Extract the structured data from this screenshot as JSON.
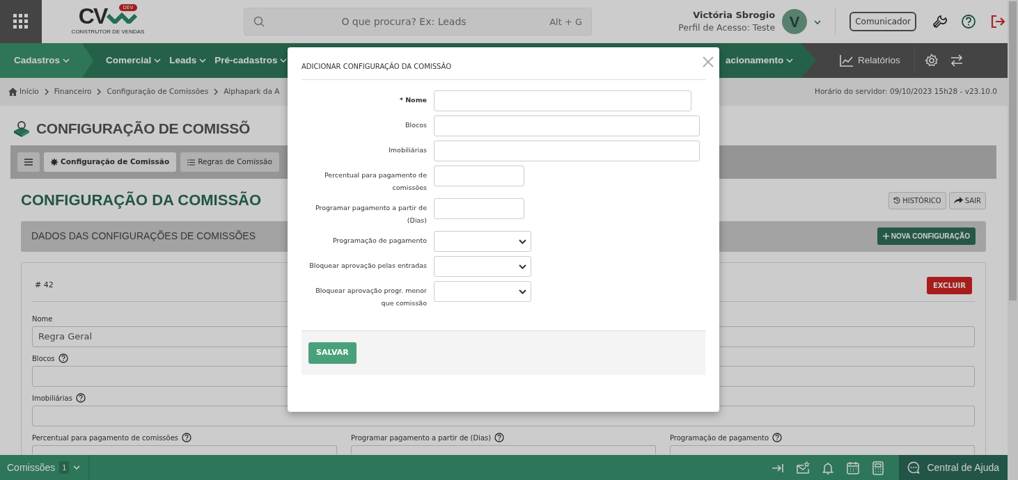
{
  "topbar": {
    "logo_text": "CV",
    "logo_badge": "DEV",
    "logo_subtitle": "CONSTRUTOR DE VENDAS",
    "search_placeholder": "O que procura? Ex: Leads",
    "search_shortcut": "Alt + G",
    "user": {
      "name": "Victória Sbrogio",
      "profile": "Perfil de Acesso: Teste",
      "initial": "V"
    },
    "communicator": "Comunicador"
  },
  "nav": {
    "items": [
      {
        "label": "Cadastros",
        "selected": true
      },
      {
        "label": "Comercial",
        "selected": false
      },
      {
        "label": "Leads",
        "selected": false
      },
      {
        "label": "Pré-cadastros",
        "selected": false
      },
      {
        "label": "acionamento",
        "selected": false
      }
    ],
    "reports": "Relatórios"
  },
  "breadcrumb": [
    "Início",
    "Financeiro",
    "Configuração de Comissões",
    "Alphapark da A"
  ],
  "server_time": "Horário do servidor: 09/10/2023 15h28 - v23.10.0",
  "page_title": "CONFIGURAÇÃO DE COMISSÕ",
  "tabs": [
    {
      "label": "Configuração de Comissão",
      "selected": true
    },
    {
      "label": "Regras de Comissão",
      "selected": false
    }
  ],
  "section_title": "CONFIGURAÇÃO DA COMISSÃO",
  "actions": [
    "HISTÓRICO",
    "SAIR"
  ],
  "panel_title": "DADOS DAS CONFIGURAÇÕES DE COMISSÕES",
  "new_button": "NOVA CONFIGURAÇÃO",
  "record": {
    "id": "# 42",
    "delete": "EXCLUIR",
    "fields": [
      {
        "label": "Nome",
        "value": "Regra Geral",
        "help": false
      },
      {
        "label": "Blocos",
        "help": true
      },
      {
        "label": "Imobiliárias",
        "help": true
      },
      {
        "label": "Percentual para pagamento de comissões",
        "help": true
      },
      {
        "label": "Programar pagamento a partir de (Dias)",
        "help": true
      },
      {
        "label": "Programação de pagamento",
        "help": true
      }
    ]
  },
  "modal": {
    "title": "ADICIONAR CONFIGURAÇÃO DA COMISSÃO",
    "save": "SALVAR",
    "fields": [
      {
        "label": "* Nome",
        "required": true,
        "kind": "text"
      },
      {
        "label": "Blocos",
        "required": false,
        "kind": "text"
      },
      {
        "label": "Imobiliárias",
        "required": false,
        "kind": "text"
      },
      {
        "label": "Percentual para pagamento de comissões",
        "required": false,
        "kind": "text"
      },
      {
        "label": "Programar pagamento a partir de (Dias)",
        "required": false,
        "kind": "text"
      },
      {
        "label": "Programação de pagamento",
        "required": false,
        "kind": "select"
      },
      {
        "label": "Bloquear aprovação pelas entradas",
        "required": false,
        "kind": "select"
      },
      {
        "label": "Bloquear aprovação progr. menor que comissão",
        "required": false,
        "kind": "select"
      }
    ]
  },
  "bottombar": {
    "tab": "Comissões",
    "count": "1",
    "help": "Central de Ajuda"
  }
}
